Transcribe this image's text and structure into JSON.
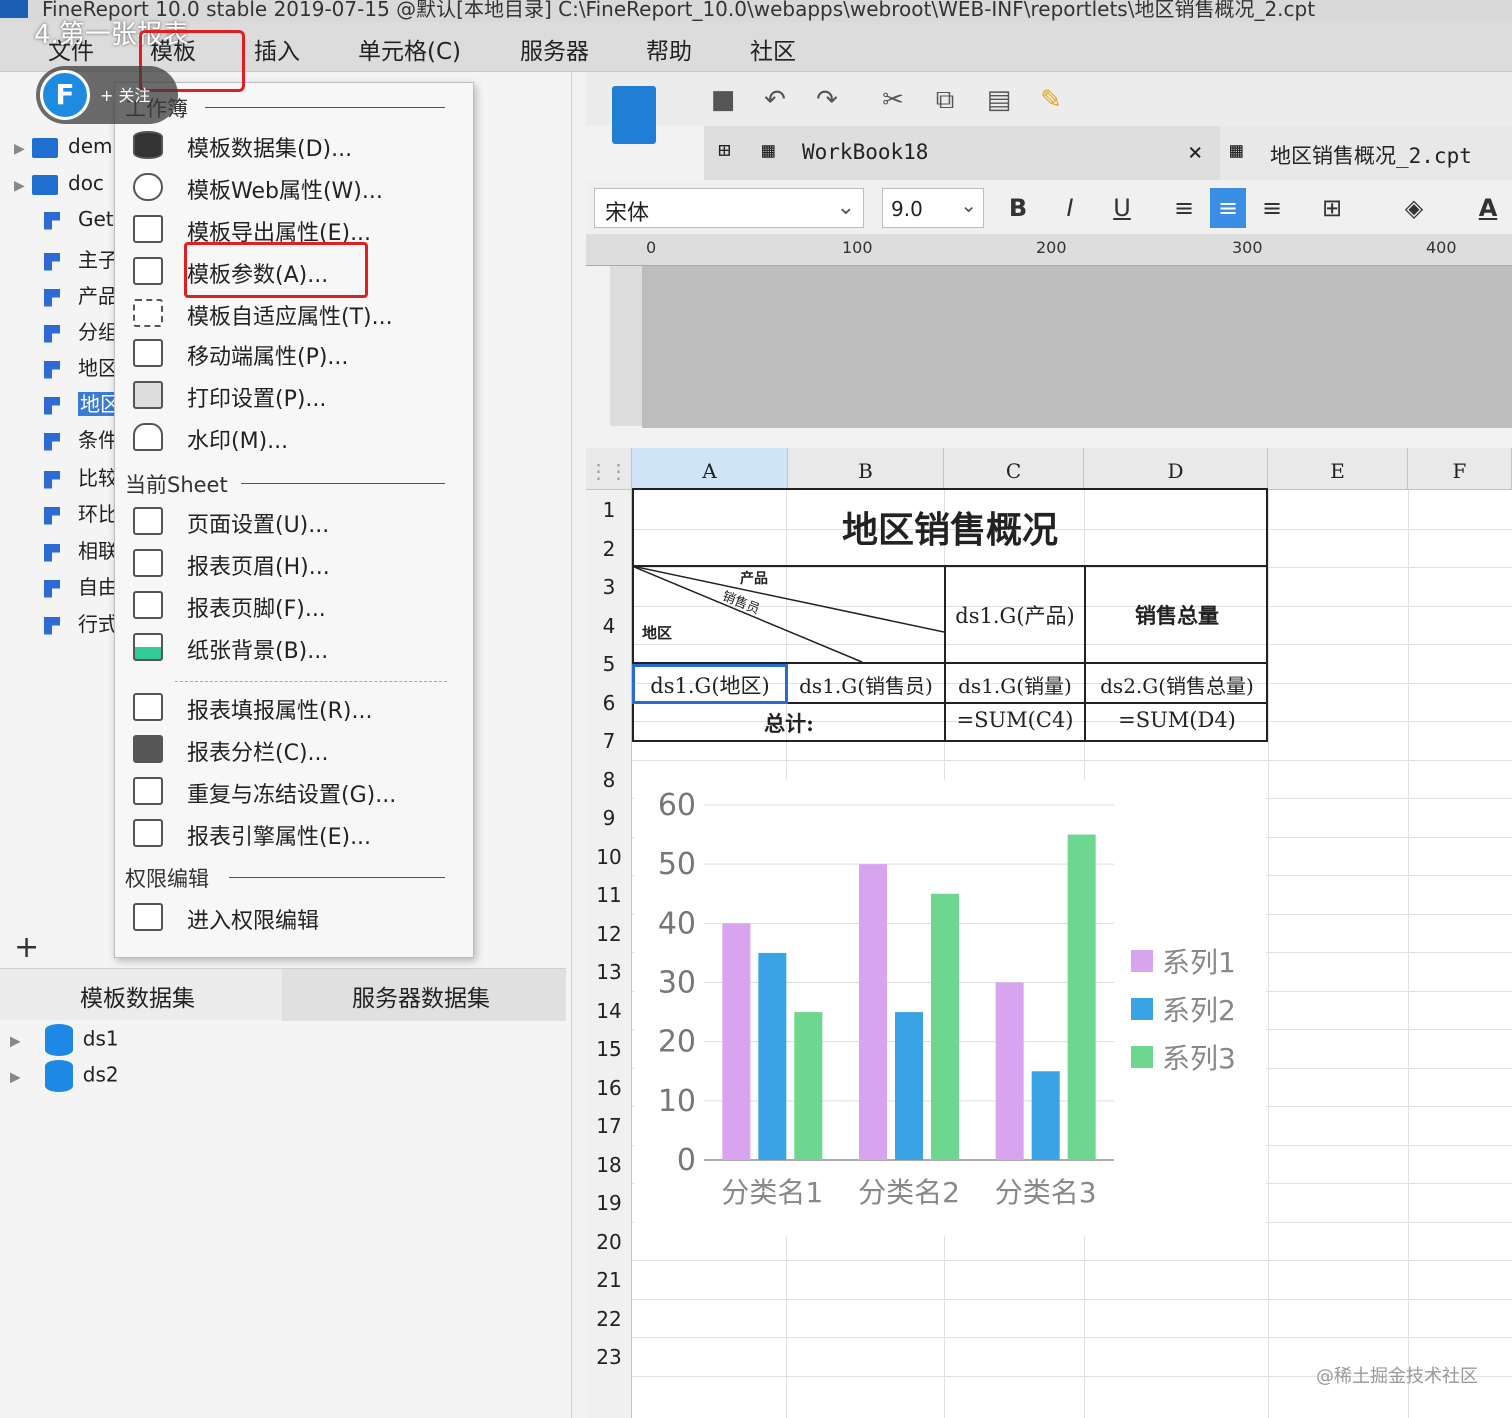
{
  "window": {
    "title": "FineReport 10.0 stable 2019-07-15 @默认[本地目录]    C:\\FineReport_10.0\\webapps\\webroot\\WEB-INF\\reportlets\\地区销售概况_2.cpt"
  },
  "overlay": {
    "caption": "4.第一张报表",
    "follow_label": "+ 关注"
  },
  "menubar": {
    "items": [
      "文件",
      "模板",
      "插入",
      "单元格(C)",
      "服务器",
      "帮助",
      "社区"
    ]
  },
  "tree": {
    "items": [
      {
        "label": "dem",
        "type": "folder"
      },
      {
        "label": "doc",
        "type": "folder"
      },
      {
        "label": "Get",
        "type": "report"
      },
      {
        "label": "主子",
        "type": "report"
      },
      {
        "label": "产品",
        "type": "report"
      },
      {
        "label": "分组",
        "type": "report"
      },
      {
        "label": "地区",
        "type": "report"
      },
      {
        "label": "地区",
        "type": "report",
        "selected": true
      },
      {
        "label": "条件",
        "type": "report"
      },
      {
        "label": "比较",
        "type": "report"
      },
      {
        "label": "环比",
        "type": "report"
      },
      {
        "label": "相联",
        "type": "report"
      },
      {
        "label": "自由",
        "type": "report"
      },
      {
        "label": "行式",
        "type": "report"
      }
    ]
  },
  "dataset_panel": {
    "tabs": [
      "模板数据集",
      "服务器数据集"
    ],
    "items": [
      "ds1",
      "ds2"
    ],
    "add_label": "+"
  },
  "template_menu": {
    "section_workbook": "工作簿",
    "section_sheet": "当前Sheet",
    "section_permission": "权限编辑",
    "workbook_items": [
      "模板数据集(D)...",
      "模板Web属性(W)...",
      "模板导出属性(E)...",
      "模板参数(A)...",
      "模板自适应属性(T)...",
      "移动端属性(P)...",
      "打印设置(P)...",
      "水印(M)..."
    ],
    "sheet_items": [
      "页面设置(U)...",
      "报表页眉(H)...",
      "报表页脚(F)...",
      "纸张背景(B)..."
    ],
    "sheet_items2": [
      "报表填报属性(R)...",
      "报表分栏(C)...",
      "重复与冻结设置(G)...",
      "报表引擎属性(E)..."
    ],
    "permission_items": [
      "进入权限编辑"
    ]
  },
  "tabs": {
    "workbook": "WorkBook18",
    "report": "地区销售概况_2.cpt",
    "close": "×"
  },
  "format": {
    "font_name": "宋体",
    "font_size": "9.0",
    "bold": "B",
    "italic": "I",
    "underline": "U",
    "font_color": "A"
  },
  "ruler": {
    "ticks": [
      "0",
      "100",
      "200",
      "300",
      "400"
    ]
  },
  "sheet": {
    "columns": [
      "A",
      "B",
      "C",
      "D",
      "E",
      "F"
    ],
    "rows": [
      "1",
      "2",
      "3",
      "4",
      "5",
      "6",
      "7",
      "8",
      "9",
      "10",
      "11",
      "12",
      "13",
      "14",
      "15",
      "16",
      "17",
      "18",
      "19",
      "20",
      "21",
      "22",
      "23"
    ],
    "title": "地区销售概况",
    "diag_product": "产品",
    "diag_seller": "销售员",
    "diag_region": "地区",
    "c3": "ds1.G(产品)",
    "d3": "销售总量",
    "a4": "ds1.G(地区)",
    "b4": "ds1.G(销售员)",
    "c4": "ds1.G(销量)",
    "d4": "ds2.G(销售总量)",
    "a5": "总计:",
    "c5": "=SUM(C4)",
    "d5": "=SUM(D4)"
  },
  "chart_data": {
    "type": "bar",
    "categories": [
      "分类名1",
      "分类名2",
      "分类名3"
    ],
    "series": [
      {
        "name": "系列1",
        "values": [
          40,
          50,
          30
        ],
        "color": "#d8a4f0"
      },
      {
        "name": "系列2",
        "values": [
          35,
          25,
          15
        ],
        "color": "#3aa3e6"
      },
      {
        "name": "系列3",
        "values": [
          25,
          45,
          55
        ],
        "color": "#6dd68f"
      }
    ],
    "yticks": [
      "0",
      "10",
      "20",
      "30",
      "40",
      "50",
      "60"
    ],
    "ylim": [
      0,
      60
    ],
    "legend": "right",
    "grid": true
  },
  "watermark": "@稀土掘金技术社区",
  "colors": {
    "highlight": "#e02020",
    "selection": "#2a6bd0"
  }
}
